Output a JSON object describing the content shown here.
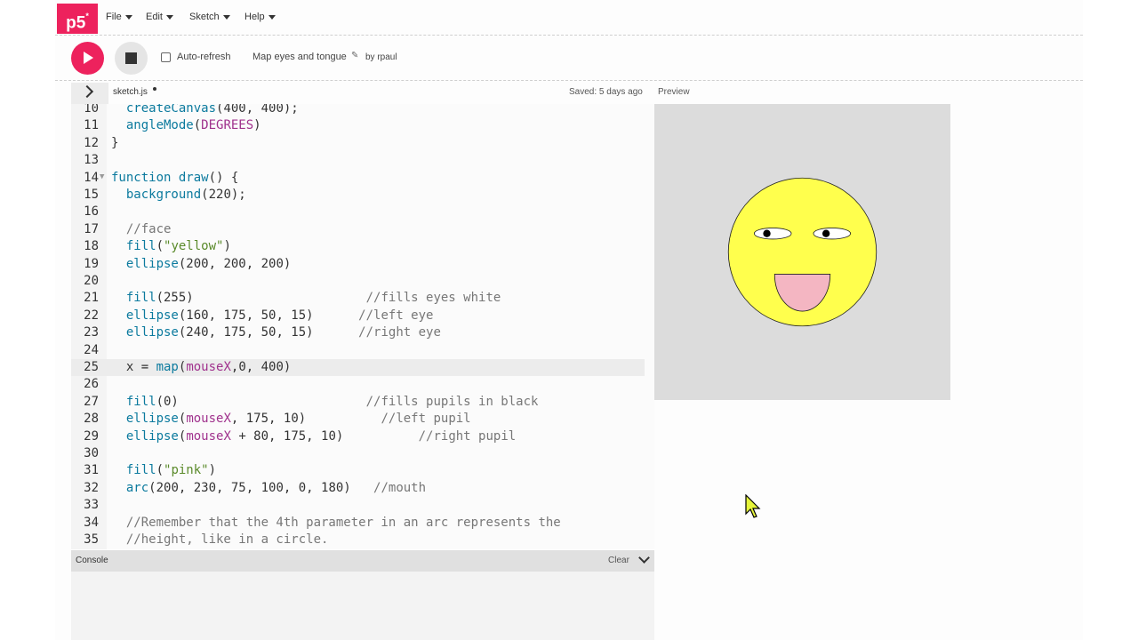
{
  "nav": {
    "logo": "p5",
    "logo_sup": "*",
    "menus": [
      "File",
      "Edit",
      "Sketch",
      "Help"
    ]
  },
  "toolbar": {
    "auto_refresh_label": "Auto-refresh",
    "auto_refresh_checked": false,
    "sketch_name": "Map eyes and tongue",
    "author": "by rpaul"
  },
  "editor": {
    "filename": "sketch.js",
    "saved": "Saved: 5 days ago",
    "preview_label": "Preview",
    "lines": [
      {
        "n": "10",
        "segs": [
          [
            "  ",
            ""
          ],
          [
            "createCanvas",
            "fn"
          ],
          [
            "(400, 400);",
            ""
          ]
        ]
      },
      {
        "n": "11",
        "segs": [
          [
            "  ",
            ""
          ],
          [
            "angleMode",
            "fn"
          ],
          [
            "(",
            ""
          ],
          [
            "DEGREES",
            "const"
          ],
          [
            ")",
            ""
          ]
        ]
      },
      {
        "n": "12",
        "segs": [
          [
            "}",
            ""
          ]
        ]
      },
      {
        "n": "13",
        "segs": []
      },
      {
        "n": "14",
        "fold": true,
        "segs": [
          [
            "function ",
            "kw"
          ],
          [
            "draw",
            "fn"
          ],
          [
            "() {",
            ""
          ]
        ]
      },
      {
        "n": "15",
        "segs": [
          [
            "  ",
            ""
          ],
          [
            "background",
            "fn"
          ],
          [
            "(220);",
            ""
          ]
        ]
      },
      {
        "n": "16",
        "segs": []
      },
      {
        "n": "17",
        "segs": [
          [
            "  ",
            ""
          ],
          [
            "//face",
            "cmt"
          ]
        ]
      },
      {
        "n": "18",
        "segs": [
          [
            "  ",
            ""
          ],
          [
            "fill",
            "fn"
          ],
          [
            "(",
            ""
          ],
          [
            "\"yellow\"",
            "str"
          ],
          [
            ")",
            ""
          ]
        ]
      },
      {
        "n": "19",
        "segs": [
          [
            "  ",
            ""
          ],
          [
            "ellipse",
            "fn"
          ],
          [
            "(200, 200, 200)",
            ""
          ]
        ]
      },
      {
        "n": "20",
        "segs": []
      },
      {
        "n": "21",
        "segs": [
          [
            "  ",
            ""
          ],
          [
            "fill",
            "fn"
          ],
          [
            "(255)                       ",
            ""
          ],
          [
            "//fills eyes white",
            "cmt"
          ]
        ]
      },
      {
        "n": "22",
        "segs": [
          [
            "  ",
            ""
          ],
          [
            "ellipse",
            "fn"
          ],
          [
            "(160, 175, 50, 15)      ",
            ""
          ],
          [
            "//left eye",
            "cmt"
          ]
        ]
      },
      {
        "n": "23",
        "segs": [
          [
            "  ",
            ""
          ],
          [
            "ellipse",
            "fn"
          ],
          [
            "(240, 175, 50, 15)      ",
            ""
          ],
          [
            "//right eye",
            "cmt"
          ]
        ]
      },
      {
        "n": "24",
        "segs": []
      },
      {
        "n": "25",
        "hl": true,
        "segs": [
          [
            "  x = ",
            ""
          ],
          [
            "map",
            "fn"
          ],
          [
            "(",
            ""
          ],
          [
            "mouseX",
            "const"
          ],
          [
            ",0, 400)",
            ""
          ]
        ]
      },
      {
        "n": "26",
        "segs": []
      },
      {
        "n": "27",
        "segs": [
          [
            "  ",
            ""
          ],
          [
            "fill",
            "fn"
          ],
          [
            "(0)                         ",
            ""
          ],
          [
            "//fills pupils in black",
            "cmt"
          ]
        ]
      },
      {
        "n": "28",
        "segs": [
          [
            "  ",
            ""
          ],
          [
            "ellipse",
            "fn"
          ],
          [
            "(",
            ""
          ],
          [
            "mouseX",
            "const"
          ],
          [
            ", 175, 10)          ",
            ""
          ],
          [
            "//left pupil",
            "cmt"
          ]
        ]
      },
      {
        "n": "29",
        "segs": [
          [
            "  ",
            ""
          ],
          [
            "ellipse",
            "fn"
          ],
          [
            "(",
            ""
          ],
          [
            "mouseX",
            "const"
          ],
          [
            " + 80, 175, 10)          ",
            ""
          ],
          [
            "//right pupil",
            "cmt"
          ]
        ]
      },
      {
        "n": "30",
        "segs": []
      },
      {
        "n": "31",
        "segs": [
          [
            "  ",
            ""
          ],
          [
            "fill",
            "fn"
          ],
          [
            "(",
            ""
          ],
          [
            "\"pink\"",
            "str"
          ],
          [
            ")",
            ""
          ]
        ]
      },
      {
        "n": "32",
        "segs": [
          [
            "  ",
            ""
          ],
          [
            "arc",
            "fn"
          ],
          [
            "(200, 230, 75, 100, 0, 180)   ",
            ""
          ],
          [
            "//mouth",
            "cmt"
          ]
        ]
      },
      {
        "n": "33",
        "segs": []
      },
      {
        "n": "34",
        "segs": [
          [
            "  ",
            ""
          ],
          [
            "//Remember that the 4th parameter in an arc represents the",
            "cmt"
          ]
        ]
      },
      {
        "n": "35",
        "segs": [
          [
            "  ",
            ""
          ],
          [
            "//height, like in a circle.",
            "cmt"
          ]
        ]
      }
    ]
  },
  "console": {
    "label": "Console",
    "clear_label": "Clear"
  },
  "colors": {
    "accent": "#ed225d",
    "face": "#ffff4d",
    "tongue": "#f4b6c2",
    "canvas_bg": "#dcdcdc"
  }
}
